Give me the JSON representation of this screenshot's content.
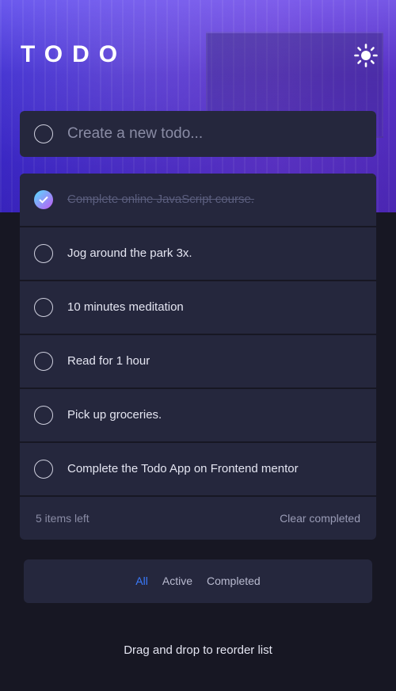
{
  "header": {
    "title": "TODO",
    "theme_icon": "sun-icon"
  },
  "new_todo": {
    "placeholder": "Create a new todo...",
    "value": ""
  },
  "todos": [
    {
      "text": "Complete online JavaScript course.",
      "completed": true
    },
    {
      "text": "Jog around the park 3x.",
      "completed": false
    },
    {
      "text": "10 minutes meditation",
      "completed": false
    },
    {
      "text": "Read for 1 hour",
      "completed": false
    },
    {
      "text": "Pick up groceries.",
      "completed": false
    },
    {
      "text": "Complete the Todo App on Frontend mentor",
      "completed": false
    }
  ],
  "footer": {
    "items_left": "5 items left",
    "clear_completed": "Clear completed"
  },
  "filters": {
    "all": "All",
    "active": "Active",
    "completed": "Completed",
    "selected": "all"
  },
  "hint": "Drag and drop to reorder list",
  "colors": {
    "background": "#171723",
    "card": "#25273d",
    "accent": "#3a7bfd",
    "check_gradient_start": "#57ddff",
    "check_gradient_end": "#c058f3"
  }
}
